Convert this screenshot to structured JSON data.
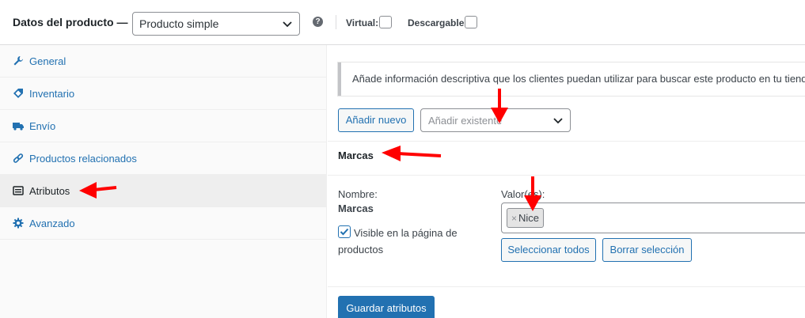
{
  "header": {
    "title": "Datos del producto —",
    "product_type": {
      "selected": "Producto simple"
    },
    "help": "?",
    "virtual_label": "Virtual:",
    "virtual_checked": false,
    "downloadable_label": "Descargable:",
    "downloadable_checked": false
  },
  "sidebar": {
    "items": [
      {
        "label": "General",
        "icon": "wrench-icon",
        "active": false
      },
      {
        "label": "Inventario",
        "icon": "tag-icon",
        "active": false
      },
      {
        "label": "Envío",
        "icon": "truck-icon",
        "active": false
      },
      {
        "label": "Productos relacionados",
        "icon": "link-icon",
        "active": false
      },
      {
        "label": "Atributos",
        "icon": "list-icon",
        "active": true
      },
      {
        "label": "Avanzado",
        "icon": "gear-icon",
        "active": false
      }
    ]
  },
  "main": {
    "notice": "Añade información descriptiva que los clientes puedan utilizar para buscar este producto en tu tienda",
    "add_new_label": "Añadir nuevo",
    "add_existing_placeholder": "Añadir existente",
    "attribute": {
      "title": "Marcas",
      "name_label": "Nombre:",
      "name_value": "Marcas",
      "visible_label": "Visible en la página de productos",
      "visible_checked": true,
      "values_label": "Valor(es):",
      "tokens": [
        {
          "remove": "×",
          "label": "Nice"
        }
      ],
      "select_all_label": "Seleccionar todos",
      "clear_label": "Borrar selección"
    },
    "save_label": "Guardar atributos"
  },
  "colors": {
    "accent": "#2271b1",
    "annotation": "#ff0000",
    "sidebar_bg": "#fafafa",
    "active_tab_bg": "#eeeeee"
  }
}
